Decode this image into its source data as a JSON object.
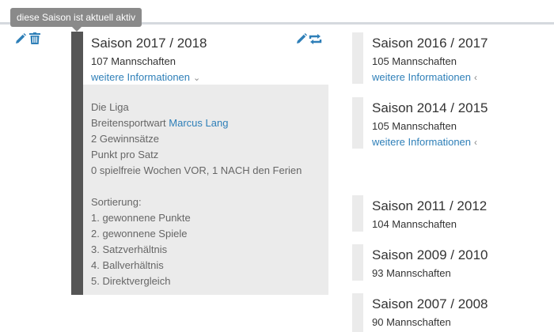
{
  "tooltip": {
    "text": "diese Saison ist aktuell aktiv"
  },
  "icons": {
    "edit": "pencil-icon",
    "delete": "trash-icon",
    "edit_active": "pencil-icon",
    "copy": "repeat-icon",
    "colors": {
      "icon": "#2e7fb8",
      "link": "#2e7fb8",
      "active_bar": "#555555",
      "panel": "#ebebeb",
      "tooltip": "#8a8a8a"
    }
  },
  "active_season": {
    "title": "Saison 2017 / 2018",
    "teams": "107 Mannschaften",
    "more_label": "weitere Informationen",
    "more_icon": "chevron-down-icon",
    "details": {
      "league": "Die Liga",
      "sport_officer_label": "Breitensportwart",
      "sport_officer_name": "Marcus Lang",
      "wins": "2 Gewinnsätze",
      "points": "Punkt pro Satz",
      "free_weeks": "0 spielfreie Wochen VOR, 1 NACH den Ferien",
      "sorting_title": "Sortierung:",
      "sorting": [
        "1. gewonnene Punkte",
        "2. gewonnene Spiele",
        "3. Satzverhältnis",
        "4. Ballverhältnis",
        "5. Direktvergleich"
      ]
    }
  },
  "seasons": [
    {
      "title": "Saison 2016 / 2017",
      "teams": "105 Mannschaften",
      "more_label": "weitere Informationen",
      "more_icon": "chevron-left-icon"
    },
    {
      "title": "Saison 2014 / 2015",
      "teams": "105 Mannschaften",
      "more_label": "weitere Informationen",
      "more_icon": "chevron-left-icon"
    },
    {
      "title": "Saison 2011 / 2012",
      "teams": "104 Mannschaften"
    },
    {
      "title": "Saison 2009 / 2010",
      "teams": "93 Mannschaften"
    },
    {
      "title": "Saison 2007 / 2008",
      "teams": "90 Mannschaften"
    }
  ]
}
